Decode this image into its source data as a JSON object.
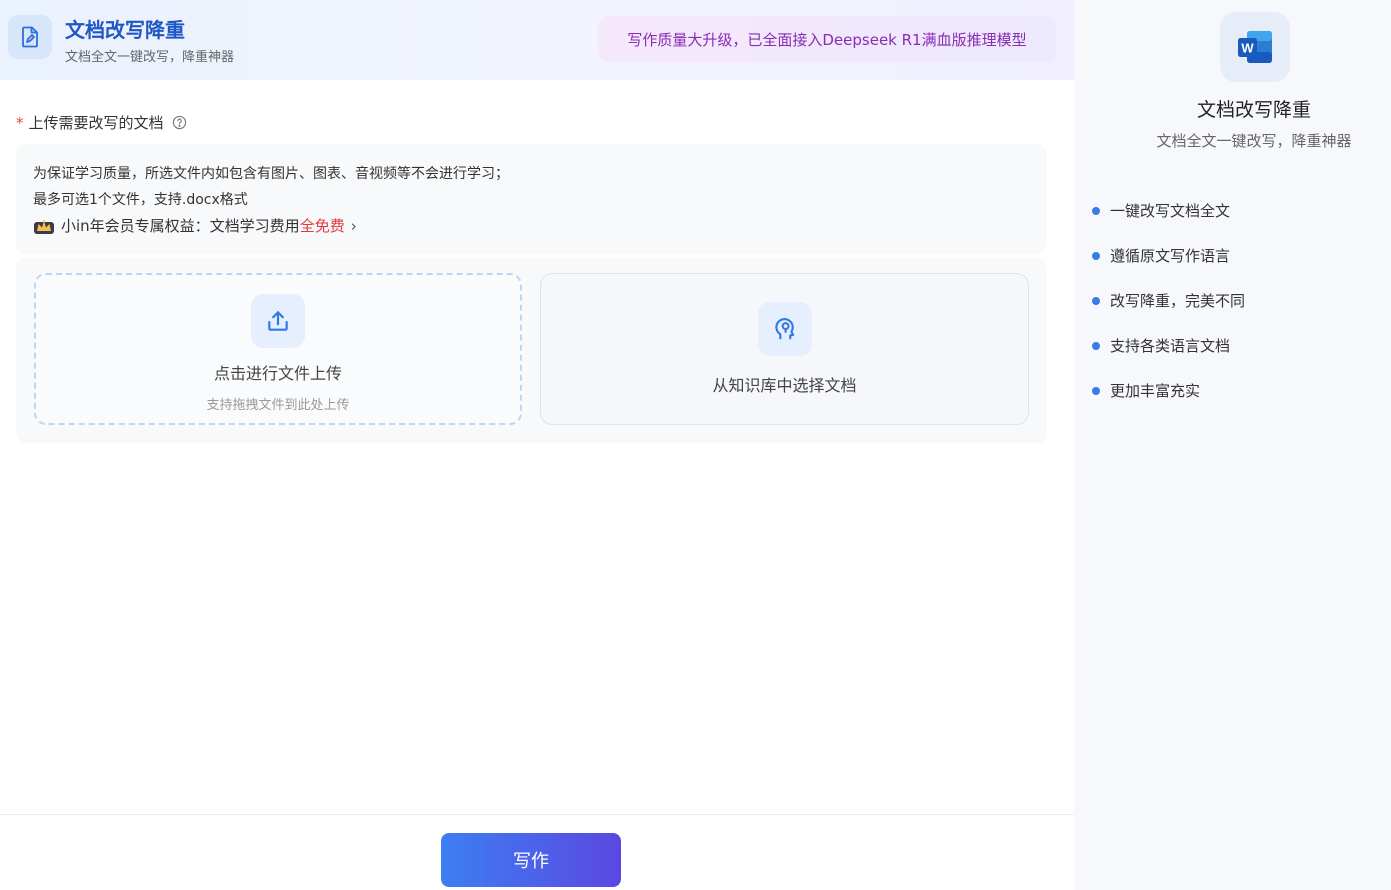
{
  "header": {
    "title": "文档改写降重",
    "subtitle": "文档全文一键改写，降重神器",
    "promo": "写作质量大升级，已全面接入Deepseek R1满血版推理模型"
  },
  "form": {
    "required_mark": "*",
    "label": "上传需要改写的文档",
    "notice_line1": "为保证学习质量，所选文件内如包含有图片、图表、音视频等不会进行学习；",
    "notice_line2": "最多可选1个文件，支持.docx格式",
    "member_prefix": "小in年会员专属权益：文档学习费用",
    "member_highlight": "全免费",
    "member_arrow": "›",
    "upload_title": "点击进行文件上传",
    "upload_hint": "支持拖拽文件到此处上传",
    "kb_title": "从知识库中选择文档"
  },
  "footer": {
    "write_label": "写作"
  },
  "sidebar": {
    "title": "文档改写降重",
    "subtitle": "文档全文一键改写，降重神器",
    "features": [
      "一键改写文档全文",
      "遵循原文写作语言",
      "改写降重，完美不同",
      "支持各类语言文档",
      "更加丰富充实"
    ]
  },
  "icons": {
    "header": "document-edit-icon",
    "help": "question-circle-icon",
    "member": "crown-badge-icon",
    "upload": "upload-icon",
    "knowledge_base": "brain-icon",
    "word": "word-app-icon"
  },
  "colors": {
    "accent": "#3d7ef4",
    "title_blue": "#1f57c7",
    "promo_purple": "#8a2bb5",
    "free_red": "#e5393b",
    "bullet": "#3a7be9"
  }
}
